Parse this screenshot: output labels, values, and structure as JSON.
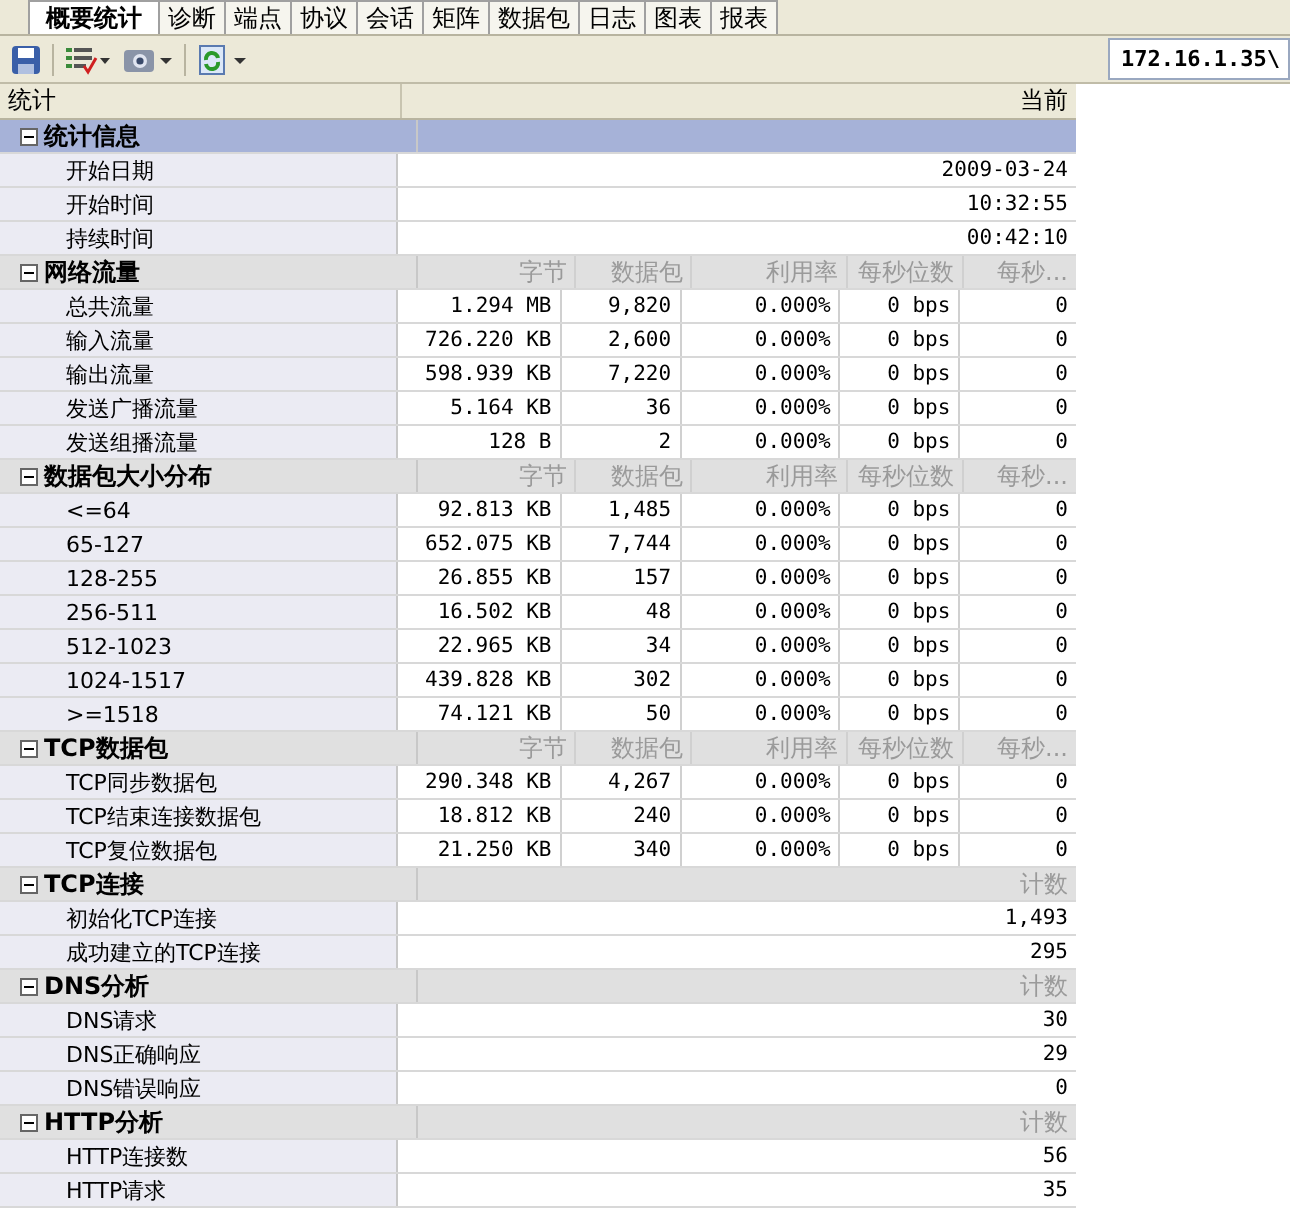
{
  "tabs": [
    {
      "label": "概要统计",
      "selected": true
    },
    {
      "label": "诊断",
      "selected": false
    },
    {
      "label": "端点",
      "selected": false
    },
    {
      "label": "协议",
      "selected": false
    },
    {
      "label": "会话",
      "selected": false
    },
    {
      "label": "矩阵",
      "selected": false
    },
    {
      "label": "数据包",
      "selected": false
    },
    {
      "label": "日志",
      "selected": false
    },
    {
      "label": "图表",
      "selected": false
    },
    {
      "label": "报表",
      "selected": false
    }
  ],
  "address": {
    "value": "172.16.1.35\\"
  },
  "table": {
    "columns": [
      "统计",
      "当前"
    ],
    "groups": [
      {
        "label": "统计信息",
        "expanded": true,
        "selected": true,
        "kind": "single",
        "rows": [
          {
            "label": "开始日期",
            "values": [
              "2009-03-24"
            ]
          },
          {
            "label": "开始时间",
            "values": [
              "10:32:55"
            ]
          },
          {
            "label": "持续时间",
            "values": [
              "00:42:10"
            ]
          }
        ]
      },
      {
        "label": "网络流量",
        "expanded": true,
        "selected": false,
        "kind": "metrics",
        "headers": [
          "字节",
          "数据包",
          "利用率",
          "每秒位数",
          "每秒..."
        ],
        "rows": [
          {
            "label": "总共流量",
            "values": [
              "1.294 MB",
              "9,820",
              "0.000%",
              "0 bps",
              "0"
            ]
          },
          {
            "label": "输入流量",
            "values": [
              "726.220 KB",
              "2,600",
              "0.000%",
              "0 bps",
              "0"
            ]
          },
          {
            "label": "输出流量",
            "values": [
              "598.939 KB",
              "7,220",
              "0.000%",
              "0 bps",
              "0"
            ]
          },
          {
            "label": "发送广播流量",
            "values": [
              "5.164 KB",
              "36",
              "0.000%",
              "0 bps",
              "0"
            ]
          },
          {
            "label": "发送组播流量",
            "values": [
              "128  B",
              "2",
              "0.000%",
              "0 bps",
              "0"
            ]
          }
        ]
      },
      {
        "label": "数据包大小分布",
        "expanded": true,
        "selected": false,
        "kind": "metrics",
        "headers": [
          "字节",
          "数据包",
          "利用率",
          "每秒位数",
          "每秒..."
        ],
        "rows": [
          {
            "label": "<=64",
            "values": [
              "92.813 KB",
              "1,485",
              "0.000%",
              "0 bps",
              "0"
            ]
          },
          {
            "label": "65-127",
            "values": [
              "652.075 KB",
              "7,744",
              "0.000%",
              "0 bps",
              "0"
            ]
          },
          {
            "label": "128-255",
            "values": [
              "26.855 KB",
              "157",
              "0.000%",
              "0 bps",
              "0"
            ]
          },
          {
            "label": "256-511",
            "values": [
              "16.502 KB",
              "48",
              "0.000%",
              "0 bps",
              "0"
            ]
          },
          {
            "label": "512-1023",
            "values": [
              "22.965 KB",
              "34",
              "0.000%",
              "0 bps",
              "0"
            ]
          },
          {
            "label": "1024-1517",
            "values": [
              "439.828 KB",
              "302",
              "0.000%",
              "0 bps",
              "0"
            ]
          },
          {
            "label": ">=1518",
            "values": [
              "74.121 KB",
              "50",
              "0.000%",
              "0 bps",
              "0"
            ]
          }
        ]
      },
      {
        "label": "TCP数据包",
        "expanded": true,
        "selected": false,
        "kind": "metrics",
        "headers": [
          "字节",
          "数据包",
          "利用率",
          "每秒位数",
          "每秒..."
        ],
        "rows": [
          {
            "label": "TCP同步数据包",
            "values": [
              "290.348 KB",
              "4,267",
              "0.000%",
              "0 bps",
              "0"
            ]
          },
          {
            "label": "TCP结束连接数据包",
            "values": [
              "18.812 KB",
              "240",
              "0.000%",
              "0 bps",
              "0"
            ]
          },
          {
            "label": "TCP复位数据包",
            "values": [
              "21.250 KB",
              "340",
              "0.000%",
              "0 bps",
              "0"
            ]
          }
        ]
      },
      {
        "label": "TCP连接",
        "expanded": true,
        "selected": false,
        "kind": "single",
        "headers": [
          "计数"
        ],
        "rows": [
          {
            "label": "初始化TCP连接",
            "values": [
              "1,493"
            ]
          },
          {
            "label": "成功建立的TCP连接",
            "values": [
              "295"
            ]
          }
        ]
      },
      {
        "label": "DNS分析",
        "expanded": true,
        "selected": false,
        "kind": "single",
        "headers": [
          "计数"
        ],
        "rows": [
          {
            "label": "DNS请求",
            "values": [
              "30"
            ]
          },
          {
            "label": "DNS正确响应",
            "values": [
              "29"
            ]
          },
          {
            "label": "DNS错误响应",
            "values": [
              "0"
            ]
          }
        ]
      },
      {
        "label": "HTTP分析",
        "expanded": true,
        "selected": false,
        "kind": "single",
        "headers": [
          "计数"
        ],
        "rows": [
          {
            "label": "HTTP连接数",
            "values": [
              "56"
            ]
          },
          {
            "label": "HTTP请求",
            "values": [
              "35"
            ]
          }
        ]
      }
    ]
  }
}
